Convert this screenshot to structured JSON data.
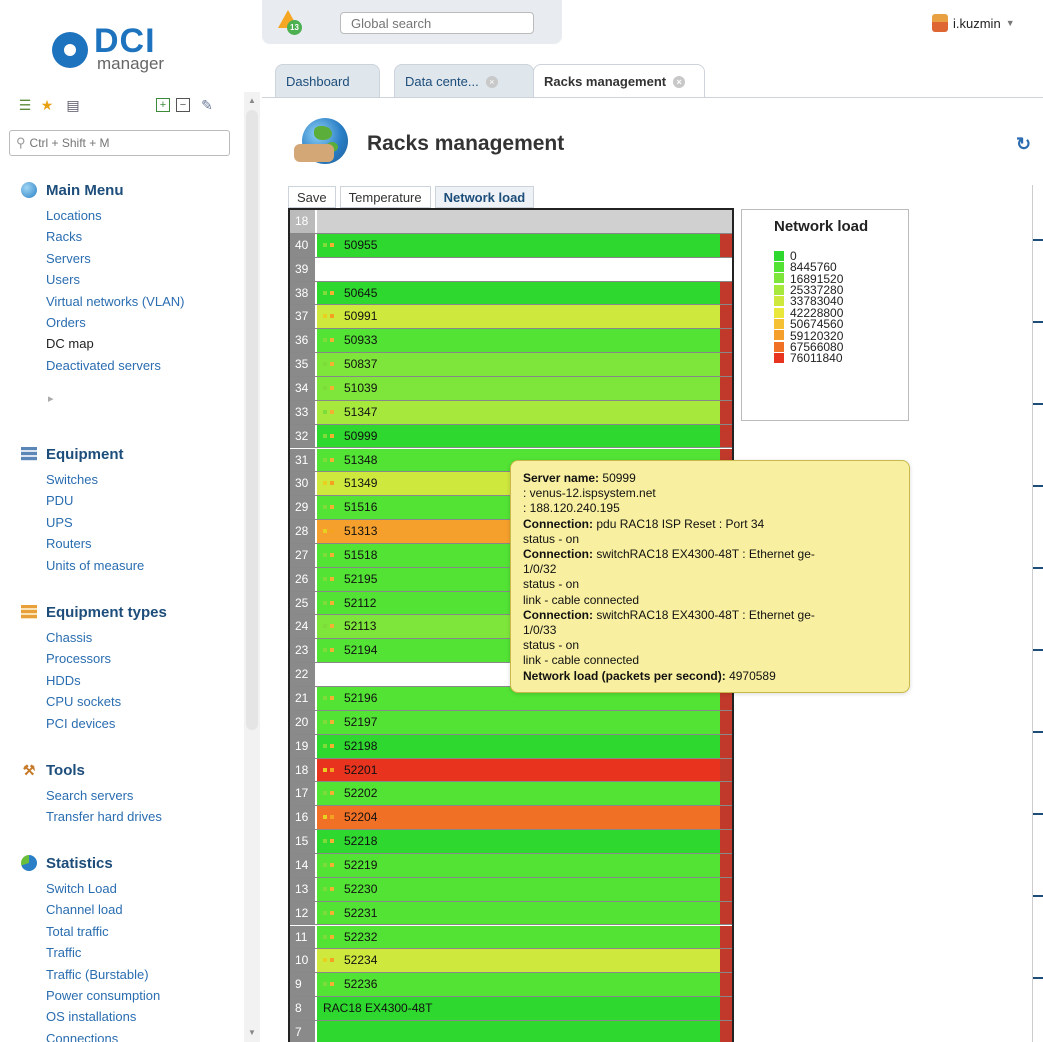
{
  "logo": {
    "brand": "DCI",
    "sub": "manager"
  },
  "sidebar": {
    "search_placeholder": "Ctrl + Shift + M",
    "sections": [
      {
        "title": "Main Menu",
        "icon": "globe-icon",
        "items": [
          "Locations",
          "Racks",
          "Servers",
          "Users",
          "Virtual networks (VLAN)",
          "Orders",
          "DC map",
          "Deactivated servers"
        ]
      },
      {
        "title": "Equipment",
        "icon": "server-icon",
        "items": [
          "Switches",
          "PDU",
          "UPS",
          "Routers",
          "Units of measure"
        ]
      },
      {
        "title": "Equipment types",
        "icon": "stack-icon",
        "items": [
          "Chassis",
          "Processors",
          "HDDs",
          "CPU sockets",
          "PCI devices"
        ]
      },
      {
        "title": "Tools",
        "icon": "tools-icon",
        "items": [
          "Search servers",
          "Transfer hard drives"
        ]
      },
      {
        "title": "Statistics",
        "icon": "pie-chart-icon",
        "items": [
          "Switch Load",
          "Channel load",
          "Total traffic",
          "Traffic",
          "Traffic (Burstable)",
          "Power consumption",
          "OS installations",
          "Connections"
        ]
      }
    ],
    "active_item": "DC map"
  },
  "topbar": {
    "alert_count": "13",
    "search_placeholder": "Global search",
    "user": "i.kuzmin"
  },
  "tabs": [
    {
      "label": "Dashboard",
      "closable": false
    },
    {
      "label": "Data cente...",
      "closable": true
    },
    {
      "label": "Racks management",
      "closable": true,
      "active": true
    }
  ],
  "page": {
    "title": "Racks management"
  },
  "toolbar": {
    "save": "Save",
    "temperature": "Temperature",
    "network_load": "Network load"
  },
  "rack": {
    "units": [
      {
        "u": "18",
        "type": "top"
      },
      {
        "u": "40",
        "label": "50955",
        "level": 0
      },
      {
        "u": "39",
        "type": "empty"
      },
      {
        "u": "38",
        "label": "50645",
        "level": 0
      },
      {
        "u": "37",
        "label": "50991",
        "level": 4
      },
      {
        "u": "36",
        "label": "50933",
        "level": 1
      },
      {
        "u": "35",
        "label": "50837",
        "level": 2
      },
      {
        "u": "34",
        "label": "51039",
        "level": 2
      },
      {
        "u": "33",
        "label": "51347",
        "level": 3
      },
      {
        "u": "32",
        "label": "50999",
        "level": 0
      },
      {
        "u": "31",
        "label": "51348",
        "level": 1
      },
      {
        "u": "30",
        "label": "51349",
        "level": 4
      },
      {
        "u": "29",
        "label": "51516",
        "level": 1
      },
      {
        "u": "28",
        "label": "51313",
        "level": 7
      },
      {
        "u": "27",
        "label": "51518",
        "level": 1
      },
      {
        "u": "26",
        "label": "52195",
        "level": 1
      },
      {
        "u": "25",
        "label": "52112",
        "level": 1
      },
      {
        "u": "24",
        "label": "52113",
        "level": 2
      },
      {
        "u": "23",
        "label": "52194",
        "level": 1
      },
      {
        "u": "22",
        "type": "empty"
      },
      {
        "u": "21",
        "label": "52196",
        "level": 1
      },
      {
        "u": "20",
        "label": "52197",
        "level": 1
      },
      {
        "u": "19",
        "label": "52198",
        "level": 0
      },
      {
        "u": "18",
        "label": "52201",
        "level": 9
      },
      {
        "u": "17",
        "label": "52202",
        "level": 1
      },
      {
        "u": "16",
        "label": "52204",
        "level": 8
      },
      {
        "u": "15",
        "label": "52218",
        "level": 0
      },
      {
        "u": "14",
        "label": "52219",
        "level": 1
      },
      {
        "u": "13",
        "label": "52230",
        "level": 1
      },
      {
        "u": "12",
        "label": "52231",
        "level": 1
      },
      {
        "u": "11",
        "label": "52232",
        "level": 1
      },
      {
        "u": "10",
        "label": "52234",
        "level": 4
      },
      {
        "u": "9",
        "label": "52236",
        "level": 1
      },
      {
        "u": "8",
        "label": "RAC18 EX4300-48T",
        "level": 0,
        "switch": true
      },
      {
        "u": "7",
        "label": "",
        "level": 0,
        "switch": true
      }
    ]
  },
  "legend": {
    "title": "Network load",
    "items": [
      {
        "value": "0",
        "color": "#2ed82e"
      },
      {
        "value": "8445760",
        "color": "#52e334"
      },
      {
        "value": "16891520",
        "color": "#7ee63a"
      },
      {
        "value": "25337280",
        "color": "#a6e83c"
      },
      {
        "value": "33783040",
        "color": "#cfe83e"
      },
      {
        "value": "42228800",
        "color": "#e9e63c"
      },
      {
        "value": "50674560",
        "color": "#f5c033"
      },
      {
        "value": "59120320",
        "color": "#f5a02c"
      },
      {
        "value": "67566080",
        "color": "#f07025"
      },
      {
        "value": "76011840",
        "color": "#e8331f"
      }
    ]
  },
  "tooltip": {
    "server_name_label": "Server name:",
    "server_name": "50999",
    "host": ": venus-12.ispsystem.net",
    "ip": ": 188.120.240.195",
    "conn_label": "Connection:",
    "conn1": "pdu RAC18 ISP Reset : Port 34",
    "status_on": "status - on",
    "conn2_a": "switchRAC18 EX4300-48T : Ethernet ge-",
    "conn2_b": "1/0/32",
    "link": "link - cable connected",
    "conn3_a": "switchRAC18 EX4300-48T : Ethernet ge-",
    "conn3_b": "1/0/33",
    "load_label": "Network load (packets per second):",
    "load_value": "4970589"
  }
}
